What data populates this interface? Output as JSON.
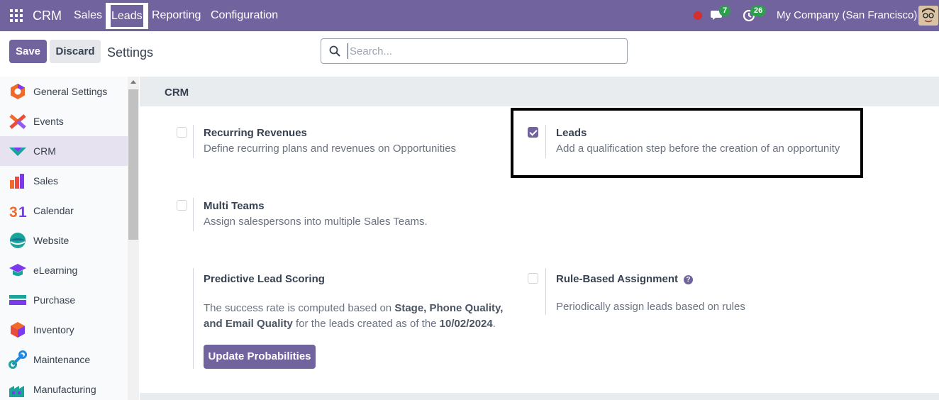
{
  "navbar": {
    "brand": "CRM",
    "menu": [
      "Sales",
      "Leads",
      "Reporting",
      "Configuration"
    ],
    "active_menu": "Leads",
    "messages_count": "7",
    "activities_count": "26",
    "company": "My Company (San Francisco)"
  },
  "control_panel": {
    "save_label": "Save",
    "discard_label": "Discard",
    "title": "Settings",
    "search_placeholder": "Search..."
  },
  "sidebar": {
    "items": [
      {
        "label": "General Settings",
        "icon": "general-settings-icon"
      },
      {
        "label": "Events",
        "icon": "events-icon"
      },
      {
        "label": "CRM",
        "icon": "crm-icon",
        "active": true
      },
      {
        "label": "Sales",
        "icon": "sales-icon"
      },
      {
        "label": "Calendar",
        "icon": "calendar-icon"
      },
      {
        "label": "Website",
        "icon": "website-icon"
      },
      {
        "label": "eLearning",
        "icon": "elearning-icon"
      },
      {
        "label": "Purchase",
        "icon": "purchase-icon"
      },
      {
        "label": "Inventory",
        "icon": "inventory-icon"
      },
      {
        "label": "Maintenance",
        "icon": "maintenance-icon"
      },
      {
        "label": "Manufacturing",
        "icon": "manufacturing-icon"
      }
    ]
  },
  "section": {
    "title": "CRM",
    "settings": {
      "recurring": {
        "title": "Recurring Revenues",
        "desc": "Define recurring plans and revenues on Opportunities",
        "checked": false
      },
      "leads": {
        "title": "Leads",
        "desc": "Add a qualification step before the creation of an opportunity",
        "checked": true
      },
      "multi_teams": {
        "title": "Multi Teams",
        "desc": "Assign salespersons into multiple Sales Teams.",
        "checked": false
      },
      "predictive": {
        "title": "Predictive Lead Scoring",
        "desc_part1": "The success rate is computed based on ",
        "desc_bold1": "Stage, Phone Quality,",
        "desc_bold2": "and Email Quality",
        "desc_part2": " for the leads created as of the ",
        "desc_date": "10/02/2024",
        "desc_end": ".",
        "button": "Update Probabilities"
      },
      "rule_based": {
        "title": "Rule-Based Assignment",
        "desc": "Periodically assign leads based on rules",
        "checked": false,
        "help": "?"
      }
    }
  },
  "colors": {
    "brand": "#71639e",
    "badge": "#2e9e4e",
    "record": "#d42e2e"
  }
}
